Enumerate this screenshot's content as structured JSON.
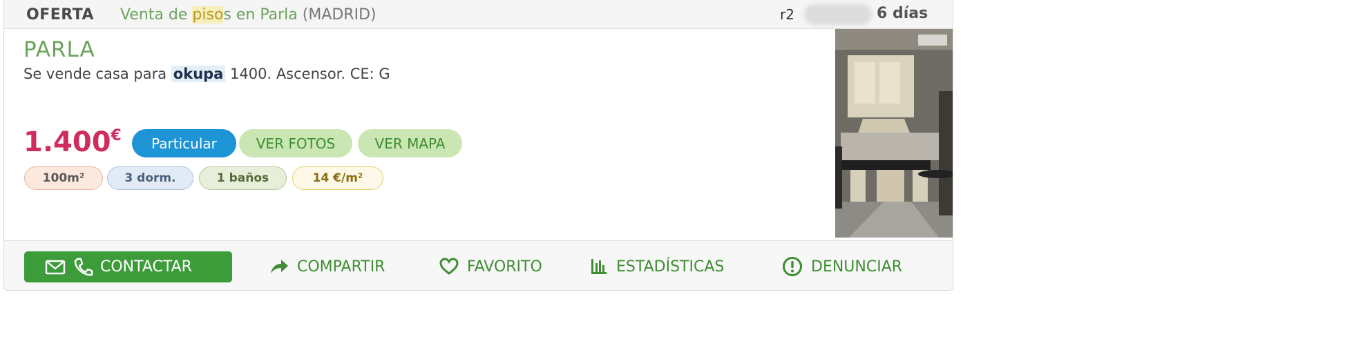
{
  "header": {
    "type": "OFERTA",
    "title_prefix": "Venta de ",
    "title_highlight": "piso",
    "title_suffix": "s en Parla",
    "location": "(MADRID)",
    "ref": "r2",
    "age": "6 días"
  },
  "listing": {
    "city": "PARLA",
    "desc_prefix": "Se vende casa para ",
    "desc_highlight": "okupa",
    "desc_suffix": " 1400. Ascensor. CE: G",
    "price": "1.400",
    "currency": "€",
    "seller_type": "Particular",
    "photos_label": "VER FOTOS",
    "map_label": "VER MAPA",
    "chips": {
      "area": "100m²",
      "rooms": "3 dorm.",
      "baths": "1 baños",
      "price_m2": "14 €/m²"
    }
  },
  "actions": {
    "contact": "CONTACTAR",
    "share": "COMPARTIR",
    "favorite": "FAVORITO",
    "stats": "ESTADÍSTICAS",
    "report": "DENUNCIAR"
  },
  "colors": {
    "green": "#3f8e33",
    "price": "#cf2d5d",
    "particular": "#1d94d5"
  },
  "icons": {
    "contact": [
      "envelope-icon",
      "phone-icon"
    ],
    "share": "share-arrow-icon",
    "favorite": "heart-icon",
    "stats": "bar-chart-icon",
    "report": "alert-circle-icon"
  }
}
